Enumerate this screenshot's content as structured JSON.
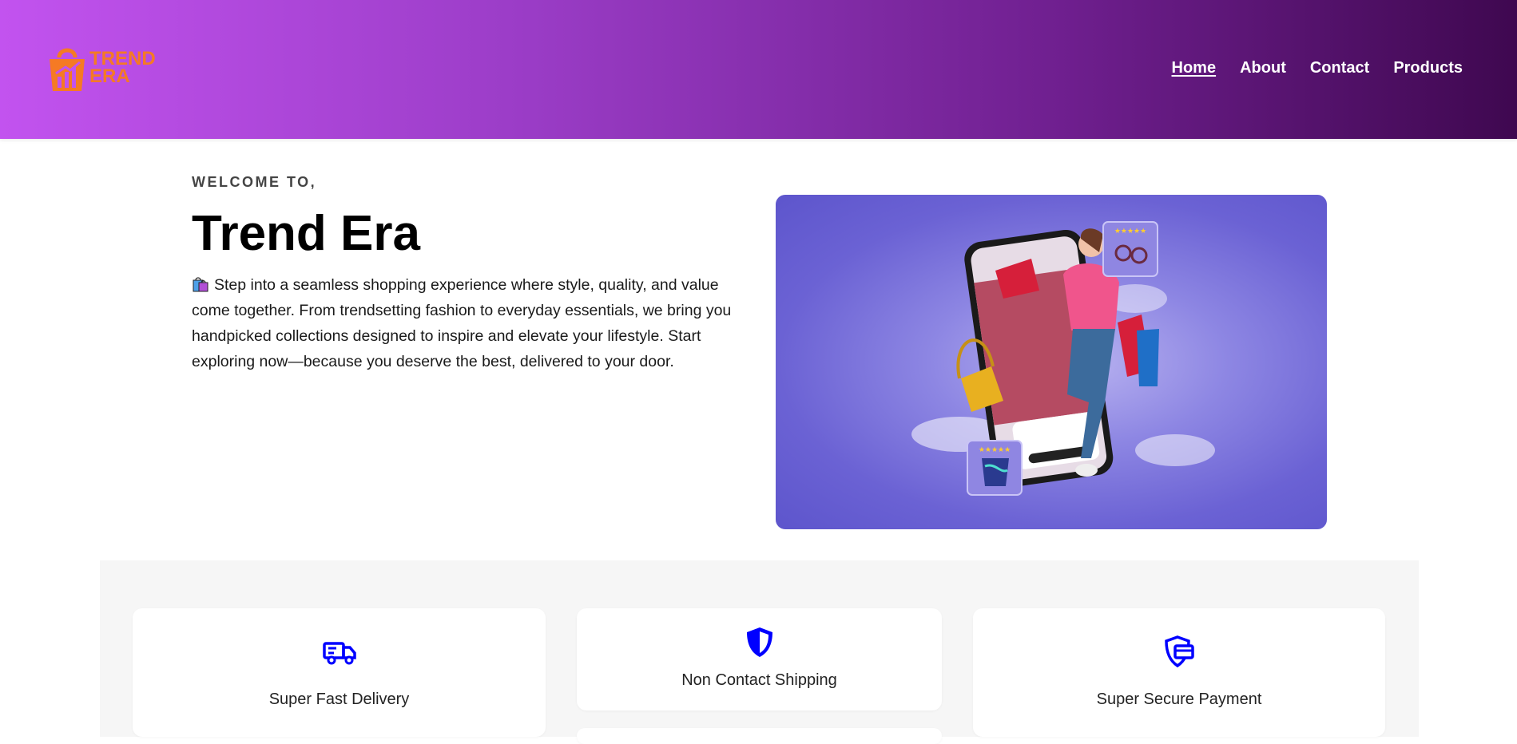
{
  "header": {
    "logo": {
      "line1": "TREND",
      "line2": "ERA",
      "color": "#f57a24"
    },
    "nav": [
      {
        "label": "Home",
        "active": true
      },
      {
        "label": "About",
        "active": false
      },
      {
        "label": "Contact",
        "active": false
      },
      {
        "label": "Products",
        "active": false
      }
    ]
  },
  "hero": {
    "eyebrow": "WELCOME TO,",
    "title": "Trend Era",
    "description": "Step into a seamless shopping experience where style, quality, and value come together. From trendsetting fashion to everyday essentials, we bring you handpicked collections designed to inspire and elevate your lifestyle. Start exploring now—because you deserve the best, delivered to your door.",
    "description_icon": "shopping-bags-icon",
    "image": "shopping-phone-illustration"
  },
  "features": [
    {
      "label": "Super Fast Delivery",
      "icon": "truck-icon"
    },
    {
      "label": "Non Contact Shipping",
      "icon": "shield-icon"
    },
    {
      "label": "Super Secure Payment",
      "icon": "secure-payment-icon"
    }
  ],
  "colors": {
    "accent": "#0000ff",
    "header_start": "#c253ef",
    "header_end": "#3f0850"
  }
}
